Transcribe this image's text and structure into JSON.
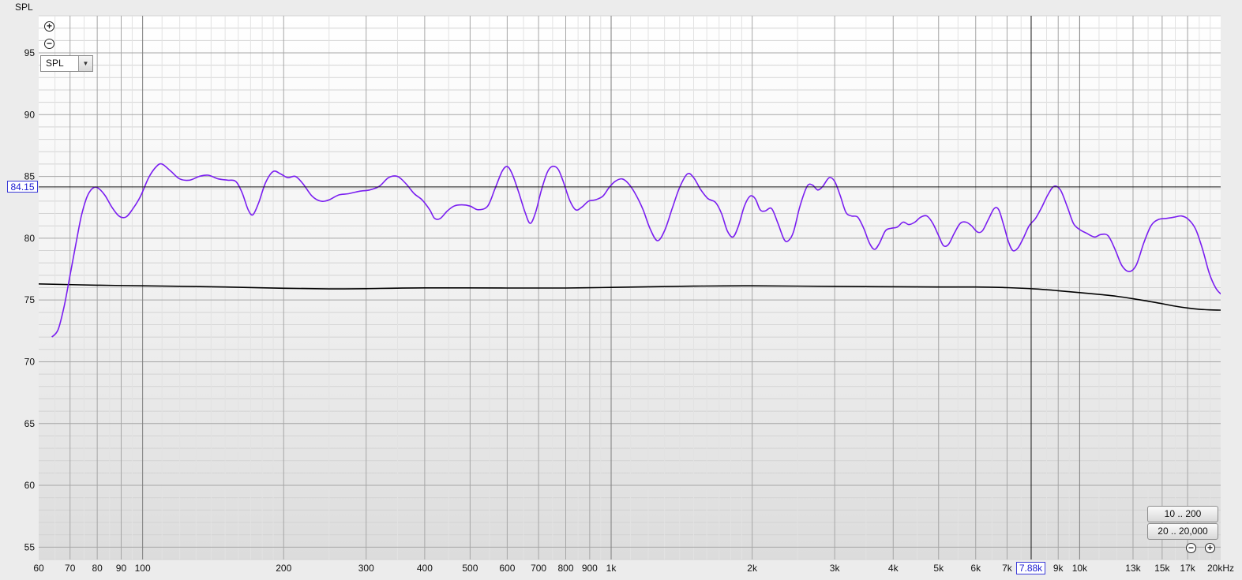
{
  "y_axis_label": "SPL",
  "range_buttons": [
    "10 .. 200",
    "20 .. 20,000"
  ],
  "dropdown": {
    "selected": "SPL"
  },
  "icons": {
    "zoom_in": "⊕",
    "zoom_out": "⊖"
  },
  "cursor": {
    "x_label": "7.88k",
    "y_label": "84.15",
    "x": 7880,
    "y": 84.15
  },
  "colors": {
    "response": "#7a1ef0",
    "reference": "#000000",
    "grid_major": "#a6a6a6",
    "grid_minor": "#d3d3d3"
  },
  "chart_data": {
    "type": "line",
    "x_scale": "log",
    "xlim": [
      60,
      20000
    ],
    "ylim": [
      54,
      98
    ],
    "y_ticks": [
      55,
      60,
      65,
      70,
      75,
      80,
      85,
      90,
      95
    ],
    "x_ticks": [
      {
        "v": 60,
        "label": "60"
      },
      {
        "v": 70,
        "label": "70"
      },
      {
        "v": 80,
        "label": "80"
      },
      {
        "v": 90,
        "label": "90"
      },
      {
        "v": 100,
        "label": "100"
      },
      {
        "v": 200,
        "label": "200"
      },
      {
        "v": 300,
        "label": "300"
      },
      {
        "v": 400,
        "label": "400"
      },
      {
        "v": 500,
        "label": "500"
      },
      {
        "v": 600,
        "label": "600"
      },
      {
        "v": 700,
        "label": "700"
      },
      {
        "v": 800,
        "label": "800"
      },
      {
        "v": 900,
        "label": "900"
      },
      {
        "v": 1000,
        "label": "1k"
      },
      {
        "v": 2000,
        "label": "2k"
      },
      {
        "v": 3000,
        "label": "3k"
      },
      {
        "v": 4000,
        "label": "4k"
      },
      {
        "v": 5000,
        "label": "5k"
      },
      {
        "v": 6000,
        "label": "6k"
      },
      {
        "v": 7000,
        "label": "7k"
      },
      {
        "v": 9000,
        "label": "9k"
      },
      {
        "v": 10000,
        "label": "10k"
      },
      {
        "v": 13000,
        "label": "13k",
        "faded": true
      },
      {
        "v": 15000,
        "label": "15k",
        "faded": true
      },
      {
        "v": 17000,
        "label": "17k",
        "faded": true
      },
      {
        "v": 20000,
        "label": "20kHz"
      }
    ],
    "series": [
      {
        "points": [
          [
            64,
            72.0
          ],
          [
            66,
            72.6
          ],
          [
            68,
            74.5
          ],
          [
            70,
            77.0
          ],
          [
            72,
            79.5
          ],
          [
            74,
            81.8
          ],
          [
            76,
            83.3
          ],
          [
            78,
            84.0
          ],
          [
            80,
            84.1
          ],
          [
            83,
            83.5
          ],
          [
            86,
            82.5
          ],
          [
            89,
            81.8
          ],
          [
            92,
            81.7
          ],
          [
            95,
            82.3
          ],
          [
            99,
            83.4
          ],
          [
            103,
            84.9
          ],
          [
            107,
            85.8
          ],
          [
            110,
            86.0
          ],
          [
            115,
            85.4
          ],
          [
            120,
            84.8
          ],
          [
            126,
            84.7
          ],
          [
            132,
            85.0
          ],
          [
            138,
            85.1
          ],
          [
            145,
            84.8
          ],
          [
            152,
            84.7
          ],
          [
            158,
            84.6
          ],
          [
            163,
            83.7
          ],
          [
            168,
            82.3
          ],
          [
            172,
            81.9
          ],
          [
            177,
            82.9
          ],
          [
            183,
            84.5
          ],
          [
            190,
            85.4
          ],
          [
            197,
            85.2
          ],
          [
            204,
            84.9
          ],
          [
            212,
            85.0
          ],
          [
            220,
            84.4
          ],
          [
            230,
            83.4
          ],
          [
            240,
            83.0
          ],
          [
            250,
            83.1
          ],
          [
            262,
            83.5
          ],
          [
            275,
            83.6
          ],
          [
            290,
            83.8
          ],
          [
            305,
            83.9
          ],
          [
            320,
            84.2
          ],
          [
            335,
            84.9
          ],
          [
            350,
            85.0
          ],
          [
            365,
            84.4
          ],
          [
            380,
            83.6
          ],
          [
            395,
            83.1
          ],
          [
            410,
            82.3
          ],
          [
            420,
            81.6
          ],
          [
            432,
            81.6
          ],
          [
            447,
            82.2
          ],
          [
            462,
            82.6
          ],
          [
            480,
            82.7
          ],
          [
            500,
            82.6
          ],
          [
            520,
            82.3
          ],
          [
            545,
            82.6
          ],
          [
            565,
            84.0
          ],
          [
            585,
            85.4
          ],
          [
            600,
            85.8
          ],
          [
            615,
            85.2
          ],
          [
            635,
            83.7
          ],
          [
            655,
            82.1
          ],
          [
            672,
            81.2
          ],
          [
            690,
            82.1
          ],
          [
            710,
            83.9
          ],
          [
            730,
            85.3
          ],
          [
            748,
            85.8
          ],
          [
            770,
            85.6
          ],
          [
            790,
            84.6
          ],
          [
            815,
            83.1
          ],
          [
            840,
            82.3
          ],
          [
            865,
            82.5
          ],
          [
            895,
            83.0
          ],
          [
            925,
            83.1
          ],
          [
            960,
            83.4
          ],
          [
            990,
            84.1
          ],
          [
            1020,
            84.6
          ],
          [
            1055,
            84.8
          ],
          [
            1090,
            84.4
          ],
          [
            1130,
            83.5
          ],
          [
            1170,
            82.3
          ],
          [
            1210,
            80.8
          ],
          [
            1255,
            79.8
          ],
          [
            1300,
            80.6
          ],
          [
            1350,
            82.4
          ],
          [
            1400,
            84.1
          ],
          [
            1455,
            85.2
          ],
          [
            1500,
            84.9
          ],
          [
            1555,
            83.9
          ],
          [
            1610,
            83.2
          ],
          [
            1670,
            82.9
          ],
          [
            1720,
            82.0
          ],
          [
            1770,
            80.6
          ],
          [
            1820,
            80.1
          ],
          [
            1870,
            81.0
          ],
          [
            1925,
            82.6
          ],
          [
            1980,
            83.4
          ],
          [
            2030,
            83.2
          ],
          [
            2080,
            82.3
          ],
          [
            2130,
            82.2
          ],
          [
            2200,
            82.4
          ],
          [
            2270,
            81.2
          ],
          [
            2340,
            79.9
          ],
          [
            2390,
            79.8
          ],
          [
            2450,
            80.5
          ],
          [
            2530,
            82.6
          ],
          [
            2620,
            84.2
          ],
          [
            2690,
            84.3
          ],
          [
            2760,
            83.9
          ],
          [
            2830,
            84.2
          ],
          [
            2920,
            84.9
          ],
          [
            3000,
            84.6
          ],
          [
            3080,
            83.5
          ],
          [
            3170,
            82.1
          ],
          [
            3260,
            81.8
          ],
          [
            3360,
            81.7
          ],
          [
            3460,
            80.8
          ],
          [
            3560,
            79.6
          ],
          [
            3650,
            79.1
          ],
          [
            3740,
            79.6
          ],
          [
            3850,
            80.6
          ],
          [
            3960,
            80.8
          ],
          [
            4080,
            80.9
          ],
          [
            4200,
            81.3
          ],
          [
            4320,
            81.1
          ],
          [
            4450,
            81.3
          ],
          [
            4580,
            81.7
          ],
          [
            4720,
            81.8
          ],
          [
            4860,
            81.2
          ],
          [
            5000,
            80.2
          ],
          [
            5120,
            79.4
          ],
          [
            5250,
            79.5
          ],
          [
            5400,
            80.4
          ],
          [
            5560,
            81.2
          ],
          [
            5720,
            81.3
          ],
          [
            5880,
            81.0
          ],
          [
            6050,
            80.5
          ],
          [
            6200,
            80.6
          ],
          [
            6380,
            81.5
          ],
          [
            6570,
            82.4
          ],
          [
            6720,
            82.3
          ],
          [
            6880,
            81.1
          ],
          [
            7050,
            79.7
          ],
          [
            7200,
            79.0
          ],
          [
            7380,
            79.2
          ],
          [
            7580,
            80.0
          ],
          [
            7800,
            81.0
          ],
          [
            8050,
            81.6
          ],
          [
            8300,
            82.5
          ],
          [
            8550,
            83.5
          ],
          [
            8820,
            84.2
          ],
          [
            9100,
            83.9
          ],
          [
            9400,
            82.6
          ],
          [
            9700,
            81.2
          ],
          [
            10000,
            80.7
          ],
          [
            10350,
            80.4
          ],
          [
            10750,
            80.1
          ],
          [
            11100,
            80.3
          ],
          [
            11500,
            80.2
          ],
          [
            11900,
            79.1
          ],
          [
            12300,
            77.8
          ],
          [
            12750,
            77.3
          ],
          [
            13200,
            77.8
          ],
          [
            13700,
            79.6
          ],
          [
            14200,
            81.0
          ],
          [
            14700,
            81.5
          ],
          [
            15300,
            81.6
          ],
          [
            15900,
            81.7
          ],
          [
            16500,
            81.8
          ],
          [
            17100,
            81.5
          ],
          [
            17700,
            80.7
          ],
          [
            18300,
            79.1
          ],
          [
            18900,
            77.2
          ],
          [
            19500,
            76.0
          ],
          [
            20000,
            75.5
          ],
          [
            20600,
            75.2
          ],
          [
            21000,
            74.9
          ]
        ]
      },
      {
        "points": [
          [
            60,
            76.3
          ],
          [
            80,
            76.2
          ],
          [
            100,
            76.15
          ],
          [
            150,
            76.05
          ],
          [
            200,
            75.95
          ],
          [
            250,
            75.9
          ],
          [
            300,
            75.92
          ],
          [
            400,
            75.98
          ],
          [
            600,
            75.97
          ],
          [
            800,
            75.97
          ],
          [
            1000,
            76.02
          ],
          [
            1500,
            76.12
          ],
          [
            2000,
            76.15
          ],
          [
            3000,
            76.1
          ],
          [
            5000,
            76.05
          ],
          [
            6000,
            76.05
          ],
          [
            7000,
            76.0
          ],
          [
            8000,
            75.9
          ],
          [
            9000,
            75.75
          ],
          [
            10000,
            75.6
          ],
          [
            11000,
            75.45
          ],
          [
            12000,
            75.3
          ],
          [
            13000,
            75.1
          ],
          [
            14000,
            74.9
          ],
          [
            15000,
            74.7
          ],
          [
            16000,
            74.5
          ],
          [
            17000,
            74.35
          ],
          [
            18000,
            74.25
          ],
          [
            19000,
            74.2
          ],
          [
            20000,
            74.18
          ]
        ]
      }
    ]
  }
}
